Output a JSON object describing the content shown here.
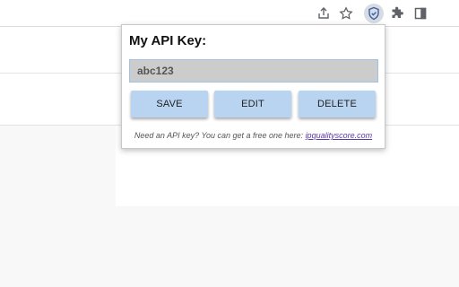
{
  "popup": {
    "title": "My API Key:",
    "api_key_value": "abc123",
    "buttons": {
      "save": "SAVE",
      "edit": "EDIT",
      "delete": "DELETE"
    },
    "note_text": "Need an API key? You can get a free one here:",
    "note_link": "ipqualityscore.com"
  },
  "toolbar": {
    "icons": [
      "share-icon",
      "star-icon",
      "extension-shield-icon",
      "puzzle-icon",
      "side-panel-icon"
    ]
  },
  "colors": {
    "button_bg": "#b9d4f1",
    "input_bg": "#cccccc",
    "link": "#5b3aa8"
  }
}
